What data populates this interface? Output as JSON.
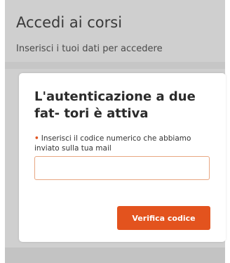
{
  "login": {
    "title": "Accedi ai corsi",
    "subtitle": "Inserisci i tuoi dati per accedere"
  },
  "two_factor_modal": {
    "title": "L'autenticazione a due fat- tori è attiva",
    "required_marker": "•",
    "code_label": "Inserisci il codice numerico che abbiamo inviato sulla tua mail",
    "code_value": "",
    "verify_button_label": "Verifica codice"
  },
  "colors": {
    "accent": "#e3531e",
    "input_border": "#e8a783",
    "backdrop": "#cfcfcf"
  }
}
